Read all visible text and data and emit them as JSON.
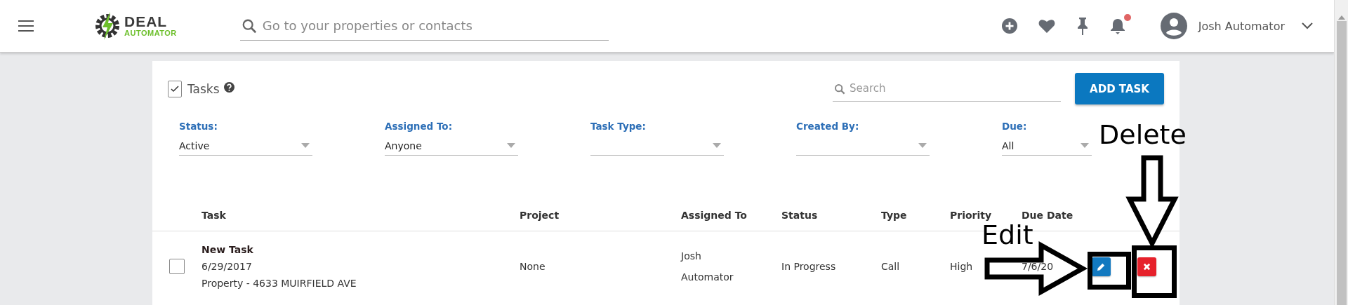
{
  "header": {
    "logo": {
      "line_1": "DEAL",
      "line_2": "AUTOMATOR"
    },
    "search": {
      "placeholder": "Go to your properties or contacts"
    },
    "notification_badge": true,
    "user": {
      "name": "Josh Automator"
    }
  },
  "tasks_panel": {
    "title": "Tasks",
    "select_all_checked": true,
    "search": {
      "placeholder": "Search"
    },
    "add_button": "ADD TASK",
    "filters": [
      {
        "label": "Status:",
        "value": "Active"
      },
      {
        "label": "Assigned To:",
        "value": "Anyone"
      },
      {
        "label": "Task Type:"
      },
      {
        "label": "Created By:"
      },
      {
        "label": "Due:",
        "value": "All"
      }
    ],
    "table": {
      "columns": [
        "Task",
        "Project",
        "Assigned To",
        "Status",
        "Type",
        "Priority",
        "Due Date"
      ],
      "rows": [
        {
          "checked": false,
          "task": "New Task",
          "date": "6/29/2017",
          "subject": "Property - 4633 MUIRFIELD AVE",
          "project": "None",
          "assigned_to": "Josh Automator",
          "status": "In Progress",
          "type": "Call",
          "priority": "High",
          "due_date": "7/6/20"
        }
      ]
    }
  },
  "annotations": [
    {
      "kind": "edit",
      "label": "Edit"
    },
    {
      "kind": "delete",
      "label": "Delete"
    }
  ]
}
